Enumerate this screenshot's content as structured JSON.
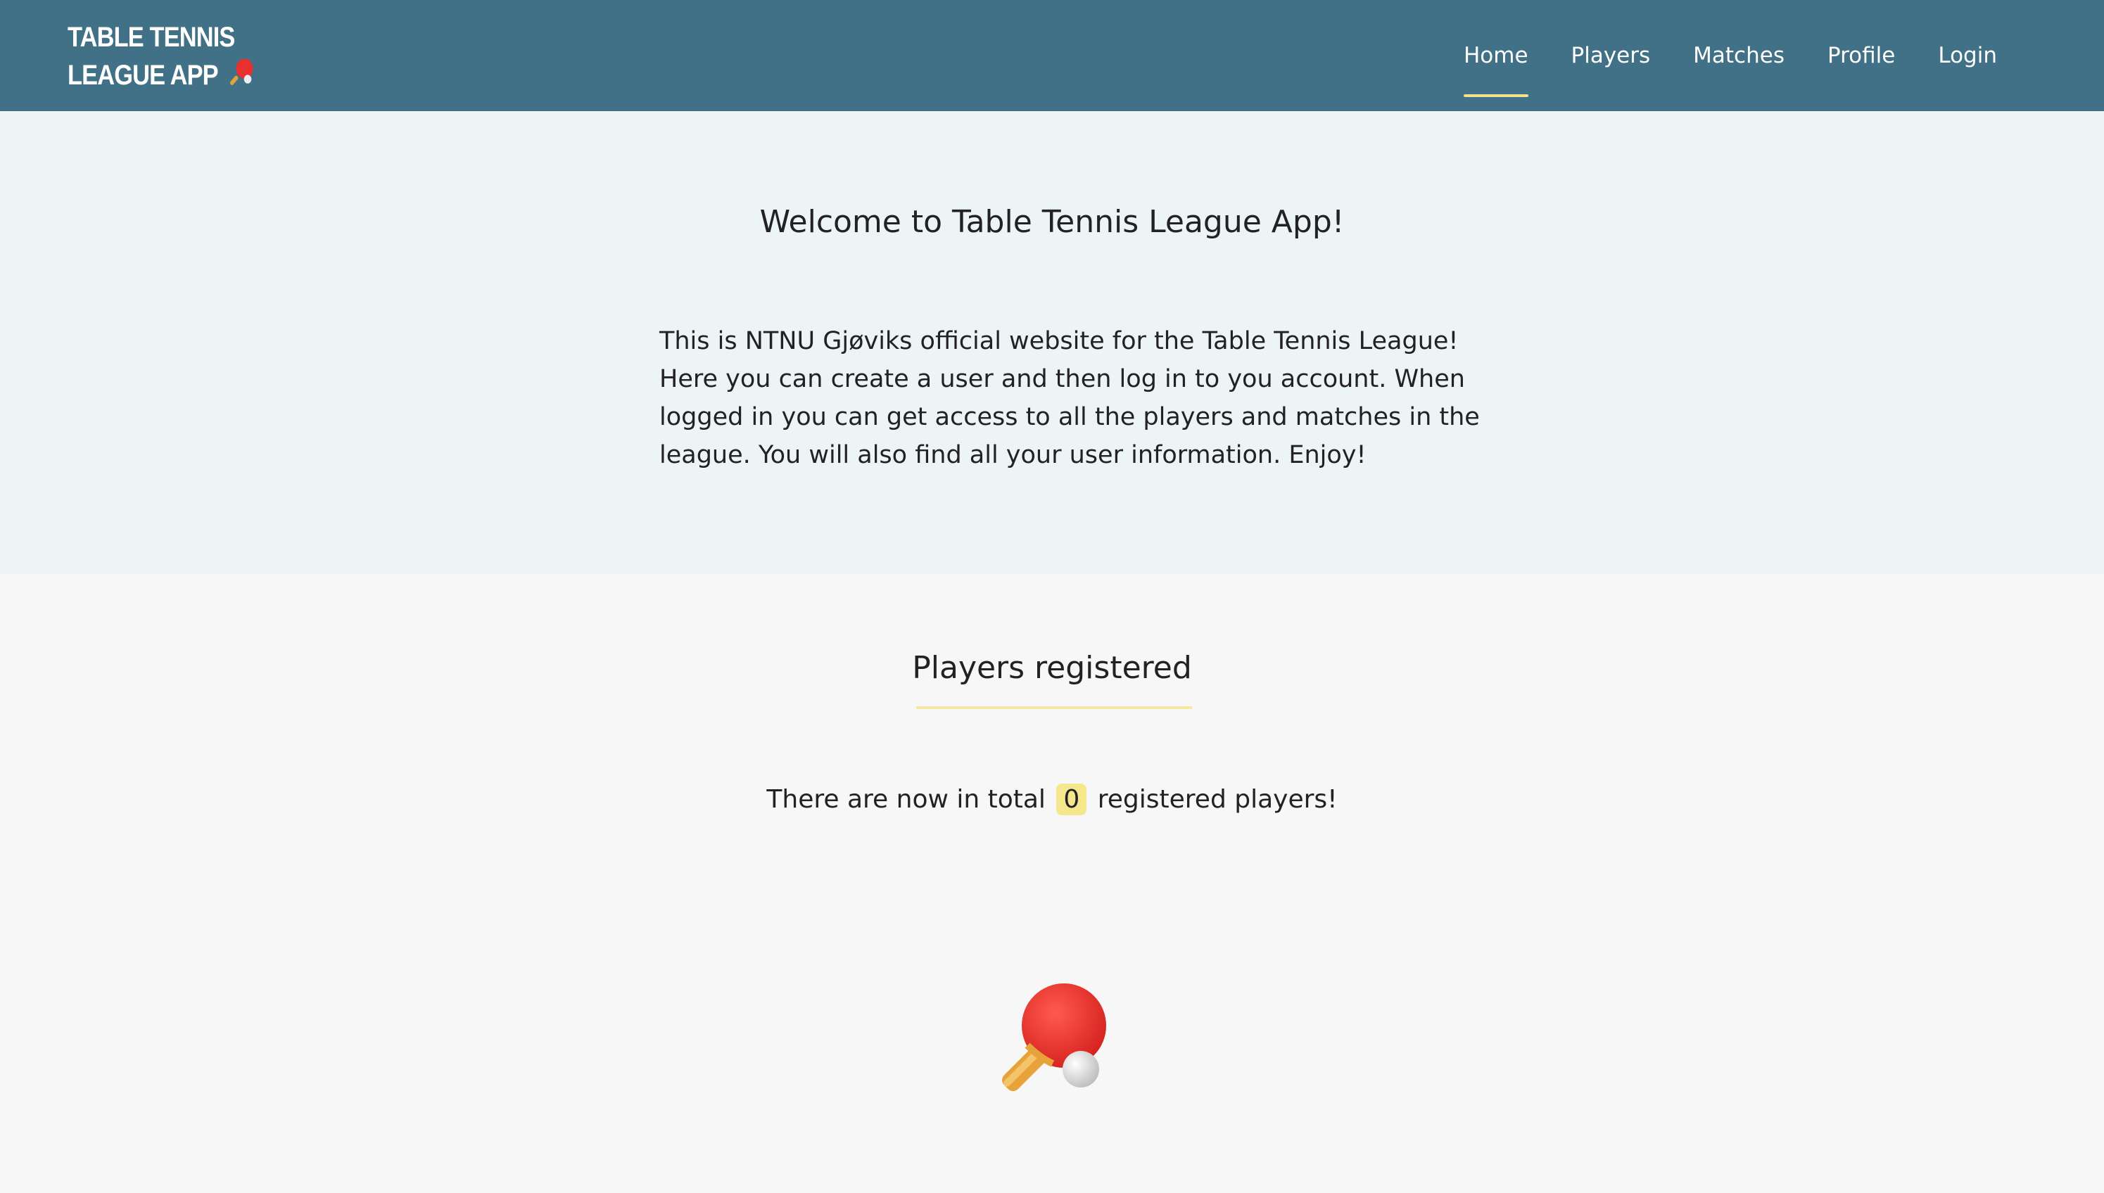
{
  "header": {
    "brand_line1": "TABLE TENNIS",
    "brand_line2": "LEAGUE APP",
    "nav": [
      {
        "label": "Home",
        "active": true
      },
      {
        "label": "Players",
        "active": false
      },
      {
        "label": "Matches",
        "active": false
      },
      {
        "label": "Profile",
        "active": false
      },
      {
        "label": "Login",
        "active": false
      }
    ]
  },
  "hero": {
    "title": "Welcome to Table Tennis League App!",
    "description": "This is NTNU Gjøviks official website for the Table Tennis League! Here you can create a user and then log in to you account. When logged in you can get access to all the players and matches in the league. You will also find all your user information. Enjoy!"
  },
  "players_section": {
    "title": "Players registered",
    "text_before": "There are now in total",
    "count": "0",
    "text_after": "registered players!"
  },
  "icons": {
    "brand_icon": "ping-pong-paddle-icon",
    "hero_icon": "ping-pong-paddle-icon"
  },
  "colors": {
    "navbar": "#407186",
    "hero_bg": "#ecf4f5",
    "page_bg": "#f7f7f7",
    "accent": "#f6e78c"
  }
}
